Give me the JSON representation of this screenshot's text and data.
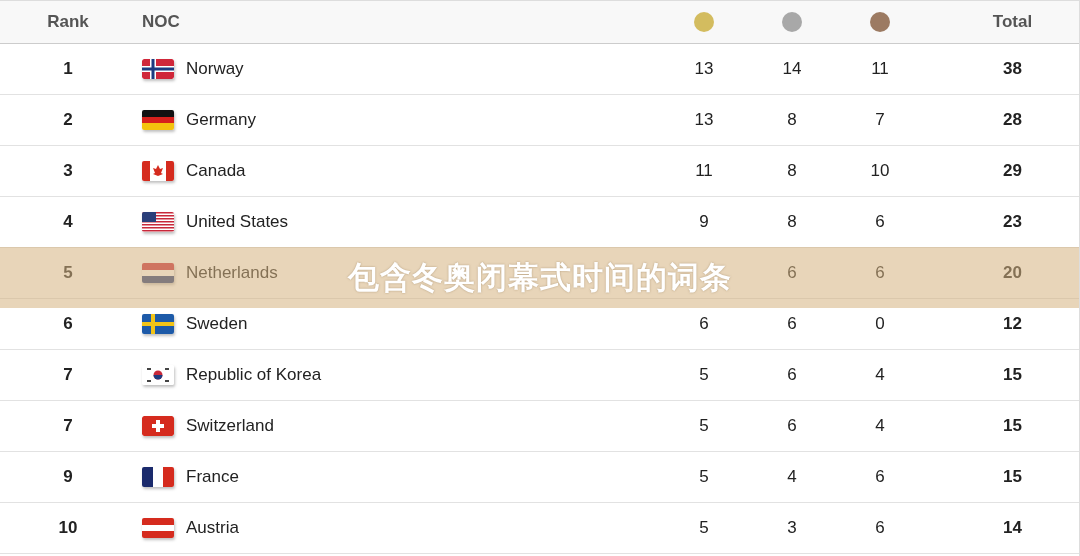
{
  "table": {
    "columns": [
      "Rank",
      "NOC",
      "Total"
    ],
    "rows": [
      {
        "rank": "1",
        "noc": "Norway",
        "gold": "13",
        "silver": "14",
        "bronze": "11",
        "total": "38"
      },
      {
        "rank": "2",
        "noc": "Germany",
        "gold": "13",
        "silver": "8",
        "bronze": "7",
        "total": "28"
      },
      {
        "rank": "3",
        "noc": "Canada",
        "gold": "11",
        "silver": "8",
        "bronze": "10",
        "total": "29"
      },
      {
        "rank": "4",
        "noc": "United States",
        "gold": "9",
        "silver": "8",
        "bronze": "6",
        "total": "23"
      },
      {
        "rank": "5",
        "noc": "Netherlands",
        "silver": "6",
        "bronze": "6",
        "total": "20"
      },
      {
        "rank": "6",
        "noc": "Sweden",
        "gold": "6",
        "silver": "6",
        "bronze": "0",
        "total": "12"
      },
      {
        "rank": "7",
        "noc": "Republic of Korea",
        "gold": "5",
        "silver": "6",
        "bronze": "4",
        "total": "15"
      },
      {
        "rank": "7",
        "noc": "Switzerland",
        "gold": "5",
        "silver": "6",
        "bronze": "4",
        "total": "15"
      },
      {
        "rank": "9",
        "noc": "France",
        "gold": "5",
        "silver": "4",
        "bronze": "6",
        "total": "15"
      },
      {
        "rank": "10",
        "noc": "Austria",
        "gold": "5",
        "silver": "3",
        "bronze": "6",
        "total": "14"
      }
    ]
  },
  "banner": {
    "text": "包含冬奥闭幕式时间的词条"
  }
}
